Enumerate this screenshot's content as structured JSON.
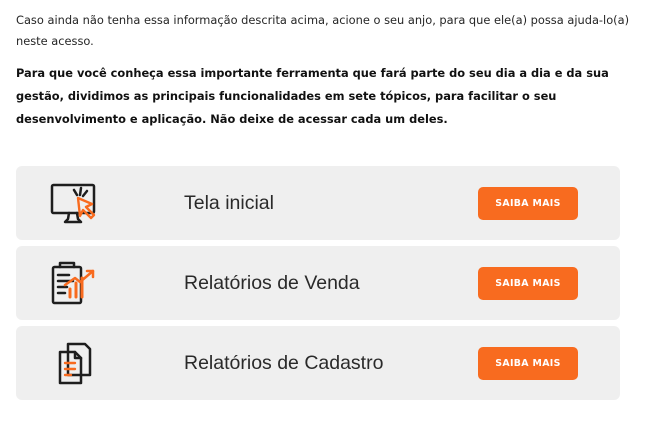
{
  "content": {
    "intro_text": "Caso ainda não tenha essa informação descrita acima, acione o seu anjo, para que ele(a) possa ajuda-lo(a) neste acesso.",
    "bold_paragraph": "Para que você conheça essa importante ferramenta que fará parte do seu dia a dia e da sua gestão, dividimos as principais funcionalidades em sete tópicos, para facilitar o seu desenvolvimento e aplicação. Não deixe de acessar cada um deles."
  },
  "cards": [
    {
      "title": "Tela inicial",
      "button_label": "SAIBA MAIS",
      "icon": "monitor-click-icon"
    },
    {
      "title": "Relatórios de Venda",
      "button_label": "SAIBA MAIS",
      "icon": "sales-report-chart-icon"
    },
    {
      "title": "Relatórios de Cadastro",
      "button_label": "SAIBA MAIS",
      "icon": "documents-copy-icon"
    }
  ],
  "colors": {
    "accent": "#f86b1f",
    "card_background": "#efefef",
    "icon_stroke": "#1e1e1e"
  }
}
